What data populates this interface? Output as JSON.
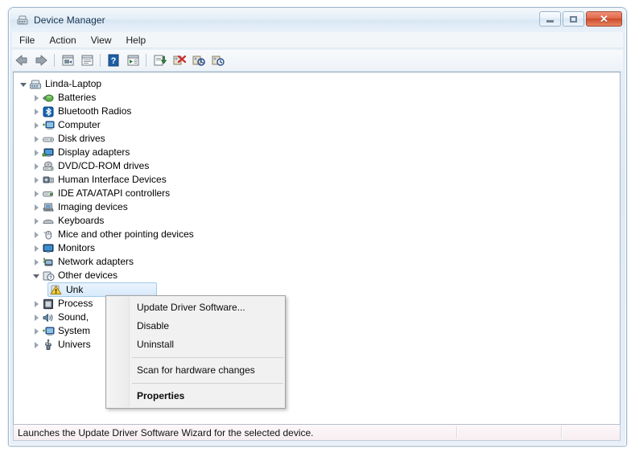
{
  "window": {
    "title": "Device Manager",
    "icon": "device-manager-icon",
    "buttons": {
      "minimize": "Minimize",
      "maximize": "Maximize",
      "close": "Close"
    }
  },
  "menubar": {
    "items": [
      {
        "label": "File"
      },
      {
        "label": "Action"
      },
      {
        "label": "View"
      },
      {
        "label": "Help"
      }
    ]
  },
  "toolbar": {
    "buttons": [
      {
        "name": "back-icon",
        "title": "Back"
      },
      {
        "name": "forward-icon",
        "title": "Forward"
      },
      {
        "name": "separator-1",
        "title": ""
      },
      {
        "name": "properties-panel-icon",
        "title": "Show/hide console tree"
      },
      {
        "name": "description-panel-icon",
        "title": "Show/hide action pane"
      },
      {
        "name": "separator-2",
        "title": ""
      },
      {
        "name": "help-icon",
        "title": "Help"
      },
      {
        "name": "show-hidden-devices-icon",
        "title": "Show hidden devices"
      },
      {
        "name": "separator-3",
        "title": ""
      },
      {
        "name": "properties-icon",
        "title": "Properties"
      },
      {
        "name": "update-driver-icon",
        "title": "Update Driver Software"
      },
      {
        "name": "uninstall-icon",
        "title": "Uninstall"
      },
      {
        "name": "scan-hardware-changes-icon",
        "title": "Scan for hardware changes"
      }
    ]
  },
  "tree": {
    "root": {
      "label": "Linda-Laptop",
      "icon": "computer-icon",
      "expanded": true
    },
    "items": [
      {
        "label": "Batteries",
        "icon": "battery-icon",
        "expanded": false,
        "level": 1
      },
      {
        "label": "Bluetooth Radios",
        "icon": "bluetooth-icon",
        "expanded": false,
        "level": 1
      },
      {
        "label": "Computer",
        "icon": "computer-node-icon",
        "expanded": false,
        "level": 1
      },
      {
        "label": "Disk drives",
        "icon": "disk-drive-icon",
        "expanded": false,
        "level": 1
      },
      {
        "label": "Display adapters",
        "icon": "display-adapter-icon",
        "expanded": false,
        "level": 1
      },
      {
        "label": "DVD/CD-ROM drives",
        "icon": "dvd-drive-icon",
        "expanded": false,
        "level": 1
      },
      {
        "label": "Human Interface Devices",
        "icon": "hid-icon",
        "expanded": false,
        "level": 1
      },
      {
        "label": "IDE ATA/ATAPI controllers",
        "icon": "ide-controller-icon",
        "expanded": false,
        "level": 1
      },
      {
        "label": "Imaging devices",
        "icon": "imaging-device-icon",
        "expanded": false,
        "level": 1
      },
      {
        "label": "Keyboards",
        "icon": "keyboard-icon",
        "expanded": false,
        "level": 1
      },
      {
        "label": "Mice and other pointing devices",
        "icon": "mouse-icon",
        "expanded": false,
        "level": 1
      },
      {
        "label": "Monitors",
        "icon": "monitor-icon",
        "expanded": false,
        "level": 1
      },
      {
        "label": "Network adapters",
        "icon": "network-adapter-icon",
        "expanded": false,
        "level": 1
      },
      {
        "label": "Other devices",
        "icon": "other-devices-icon",
        "expanded": true,
        "level": 1
      }
    ],
    "selected_item": {
      "label": "Unk",
      "full_label": "Unknown device",
      "icon": "warning-triangle-icon",
      "level": 2,
      "selected": true
    },
    "items_after": [
      {
        "label": "Process",
        "icon": "processor-icon",
        "expanded": false,
        "level": 1
      },
      {
        "label": "Sound, ",
        "icon": "sound-icon",
        "expanded": false,
        "level": 1
      },
      {
        "label": "System ",
        "icon": "system-device-icon",
        "expanded": false,
        "level": 1
      },
      {
        "label": "Univers",
        "icon": "usb-controller-icon",
        "expanded": false,
        "level": 1
      }
    ]
  },
  "context_menu": {
    "items": [
      {
        "label": "Update Driver Software...",
        "bold": false,
        "type": "item"
      },
      {
        "label": "Disable",
        "bold": false,
        "type": "item"
      },
      {
        "label": "Uninstall",
        "bold": false,
        "type": "item"
      },
      {
        "label": "",
        "type": "separator"
      },
      {
        "label": "Scan for hardware changes",
        "bold": false,
        "type": "item"
      },
      {
        "label": "",
        "type": "separator"
      },
      {
        "label": "Properties",
        "bold": true,
        "type": "item"
      }
    ]
  },
  "statusbar": {
    "text": "Launches the Update Driver Software Wizard for the selected device.",
    "pane2": "",
    "pane3": ""
  },
  "colors": {
    "title_text": "#14324f",
    "close_button": "#cc4c2b",
    "selection": "#d7eafb",
    "warning": "#f5c842",
    "frame": "#9fb6cd"
  }
}
